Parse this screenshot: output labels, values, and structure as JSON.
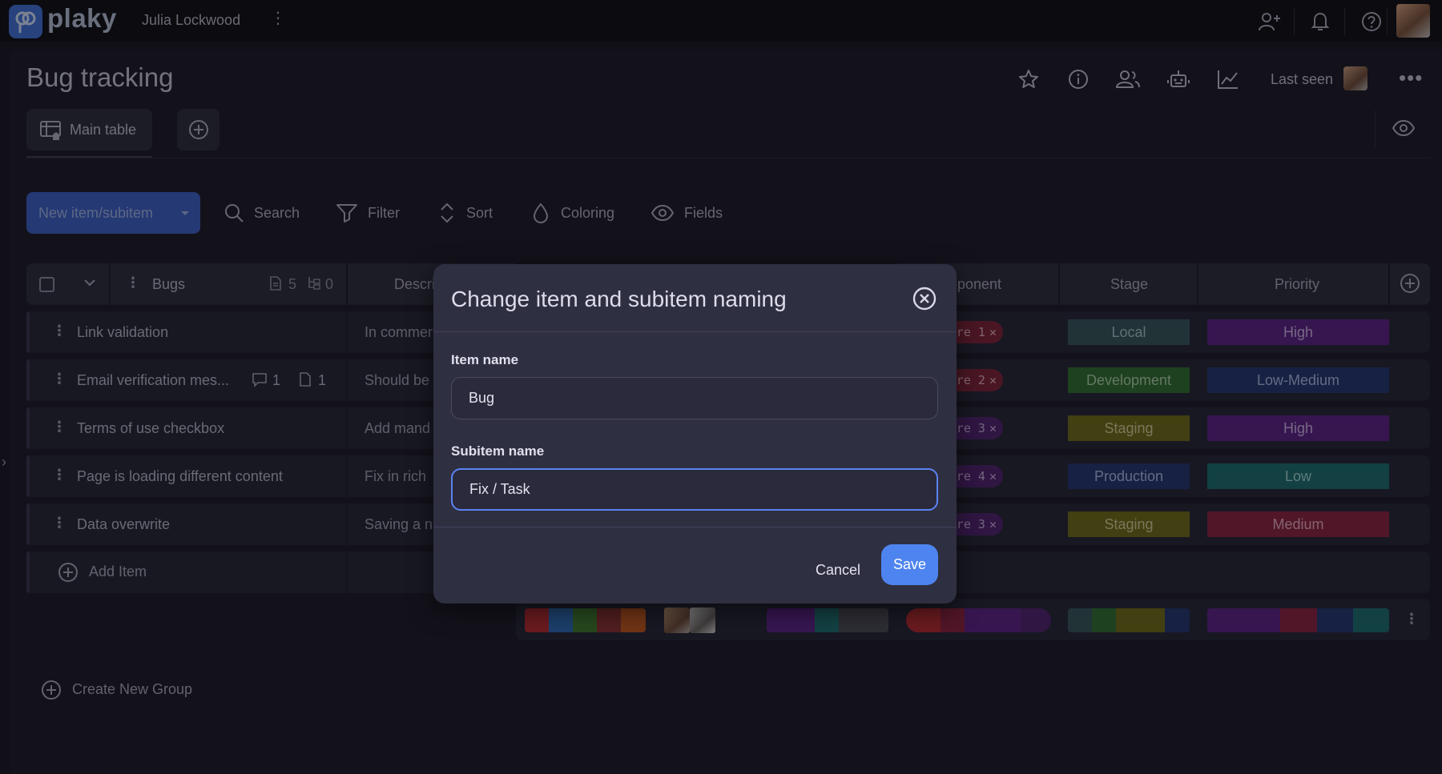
{
  "app": {
    "logo_text": "plaky",
    "user_name": "Julia Lockwood"
  },
  "board": {
    "title": "Bug tracking",
    "last_seen_label": "Last seen"
  },
  "tabs": [
    {
      "label": "Main table"
    }
  ],
  "toolbar": {
    "new_item_label": "New item/subitem",
    "search_label": "Search",
    "filter_label": "Filter",
    "sort_label": "Sort",
    "coloring_label": "Coloring",
    "fields_label": "Fields"
  },
  "table": {
    "group_name": "Bugs",
    "item_count": "5",
    "subitem_count": "0",
    "columns": {
      "description": "Descri",
      "component": "mponent",
      "stage": "Stage",
      "priority": "Priority"
    },
    "rows": [
      {
        "name": "Link validation",
        "description": "In commer",
        "component": "re 1",
        "stage": "Local",
        "priority": "High"
      },
      {
        "name": "Email verification mes...",
        "comments": "1",
        "files": "1",
        "description": "Should be",
        "component": "re 2",
        "stage": "Development",
        "priority": "Low-Medium"
      },
      {
        "name": "Terms of use checkbox",
        "description": "Add mand",
        "component": "re 3",
        "stage": "Staging",
        "priority": "High"
      },
      {
        "name": "Page is loading different content",
        "description": "Fix in rich",
        "component": "re 4",
        "stage": "Production",
        "priority": "Low"
      },
      {
        "name": "Data overwrite",
        "description": "Saving a n",
        "component": "re 3",
        "stage": "Staging",
        "priority": "Medium"
      }
    ],
    "add_item_label": "Add Item",
    "create_group_label": "Create New Group"
  },
  "colors": {
    "stage": {
      "Local": "#35545a",
      "Development": "#2f6e2c",
      "Staging": "#6f6b14",
      "Production": "#22336e"
    },
    "priority": {
      "High": "#5b1f86",
      "Low-Medium": "#22336e",
      "Low": "#1a6e6e",
      "Medium": "#8a1f3c"
    },
    "accent": "#4e84ef"
  },
  "modal": {
    "title": "Change item and subitem naming",
    "item_name_label": "Item name",
    "item_name_value": "Bug",
    "subitem_name_label": "Subitem name",
    "subitem_name_value": "Fix / Task",
    "cancel_label": "Cancel",
    "save_label": "Save"
  }
}
